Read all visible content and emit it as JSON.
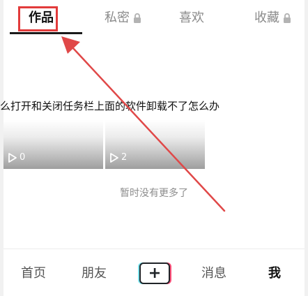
{
  "tabs": [
    {
      "label": "作品",
      "locked": false,
      "active": true
    },
    {
      "label": "私密",
      "locked": true,
      "active": false
    },
    {
      "label": "喜欢",
      "locked": false,
      "active": false
    },
    {
      "label": "收藏",
      "locked": true,
      "active": false
    }
  ],
  "video": {
    "title": "么打开和关闭任务栏上面的软件卸载不了怎么办"
  },
  "thumbnails": [
    {
      "count": "0"
    },
    {
      "count": "2"
    }
  ],
  "status": {
    "no_more": "暂时没有更多了"
  },
  "bottom_nav": [
    {
      "label": "首页"
    },
    {
      "label": "朋友"
    },
    {
      "label": "消息"
    },
    {
      "label": "我"
    }
  ],
  "icons": {
    "lock": "lock-icon",
    "play": "play-icon",
    "plus": "plus-icon"
  },
  "colors": {
    "highlight": "#e23b3b",
    "active_text": "#111111",
    "inactive_text": "#8a8a8a"
  }
}
